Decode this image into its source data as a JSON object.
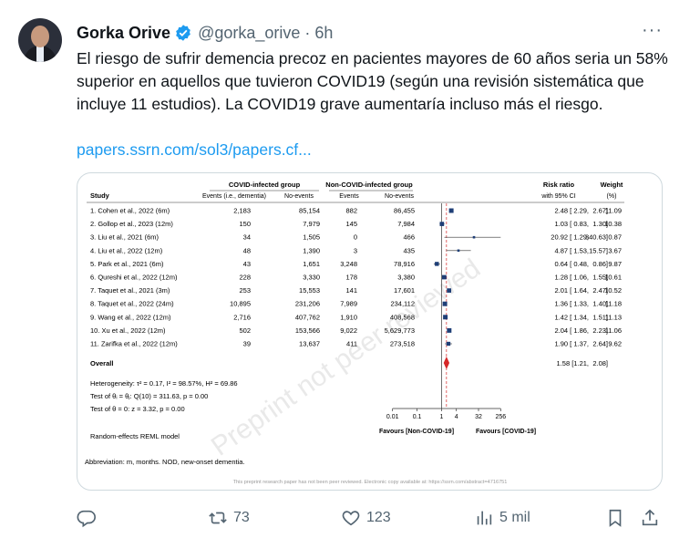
{
  "author": {
    "name": "Gorka Orive",
    "handle": "@gorka_orive",
    "separator": "·",
    "time": "6h",
    "more": "···"
  },
  "tweet": {
    "text": "El riesgo de sufrir demencia precoz en pacientes mayores de 60 años seria un 58% superior en aquellos que tuvieron COVID19 (según una revisión sistemática que incluye 11 estudios). La COVID19 grave aumentaría incluso más el riesgo.",
    "link": "papers.ssrn.com/sol3/papers.cf..."
  },
  "figure": {
    "group_covid": "COVID-infected group",
    "group_noncovid": "Non-COVID-infected group",
    "risk_ratio_label": "Risk ratio",
    "ci_label": "with 95% CI",
    "weight_label": "Weight",
    "weight_unit": "(%)",
    "col_study": "Study",
    "col_events_dementia": "Events (i.e., dementia)",
    "col_noevents": "No-events",
    "col_events": "Events",
    "col_noevents2": "No-events",
    "watermark": "Preprint not peer reviewed",
    "overall_label": "Overall",
    "overall_rr": "1.58 [1.21,",
    "overall_hi": "2.08]",
    "heterogeneity": "Heterogeneity: τ² = 0.17, I² = 98.57%, H² = 69.86",
    "test_theta_i": "Test of θᵢ = θⱼ: Q(10) = 311.63, p = 0.00",
    "test_theta": "Test of θ = 0: z = 3.32, p = 0.00",
    "model": "Random-effects REML model",
    "abbrev": "Abbreviation: m, months. NOD, new-onset dementia.",
    "footer": "This preprint research paper has not been peer reviewed. Electronic copy available at: https://ssrn.com/abstract=4716751",
    "favours_left": "Favours [Non-COVID-19]",
    "favours_right": "Favours [COVID-19]",
    "axis_ticks": [
      "0.01",
      "0.1",
      "1",
      "4",
      "32",
      "256"
    ],
    "studies": [
      {
        "study": "1. Cohen et al., 2022 (6m)",
        "ev": "2,183",
        "noev": "85,154",
        "ev2": "882",
        "noev2": "86,455",
        "rr": 2.48,
        "lo": 2.29,
        "hi": 2.67,
        "rr_text": "2.48 [ 2.29,",
        "hi_text": "2.67]",
        "weight": "11.09"
      },
      {
        "study": "2. Gollop et al., 2023 (12m)",
        "ev": "150",
        "noev": "7,979",
        "ev2": "145",
        "noev2": "7,984",
        "rr": 1.03,
        "lo": 0.83,
        "hi": 1.3,
        "rr_text": "1.03 [ 0.83,",
        "hi_text": "1.30]",
        "weight": "10.38"
      },
      {
        "study": "3. Liu et al., 2021 (6m)",
        "ev": "34",
        "noev": "1,505",
        "ev2": "0",
        "noev2": "466",
        "rr": 20.92,
        "lo": 1.29,
        "hi": 340.63,
        "rr_text": "20.92 [ 1.29,",
        "hi_text": "340.63]",
        "weight": "0.87"
      },
      {
        "study": "4. Liu et al., 2022 (12m)",
        "ev": "48",
        "noev": "1,390",
        "ev2": "3",
        "noev2": "435",
        "rr": 4.87,
        "lo": 1.53,
        "hi": 15.57,
        "rr_text": "4.87 [ 1.53,",
        "hi_text": "15.57]",
        "weight": "3.67"
      },
      {
        "study": "5. Park et al., 2021 (6m)",
        "ev": "43",
        "noev": "1,651",
        "ev2": "3,248",
        "noev2": "78,916",
        "rr": 0.64,
        "lo": 0.48,
        "hi": 0.86,
        "rr_text": "0.64 [ 0.48,",
        "hi_text": "0.86]",
        "weight": "9.87"
      },
      {
        "study": "6. Qureshi et al., 2022 (12m)",
        "ev": "228",
        "noev": "3,330",
        "ev2": "178",
        "noev2": "3,380",
        "rr": 1.28,
        "lo": 1.06,
        "hi": 1.55,
        "rr_text": "1.28 [ 1.06,",
        "hi_text": "1.55]",
        "weight": "10.61"
      },
      {
        "study": "7. Taquet et al., 2021 (3m)",
        "ev": "253",
        "noev": "15,553",
        "ev2": "141",
        "noev2": "17,601",
        "rr": 2.01,
        "lo": 1.64,
        "hi": 2.47,
        "rr_text": "2.01 [ 1.64,",
        "hi_text": "2.47]",
        "weight": "10.52"
      },
      {
        "study": "8. Taquet et al., 2022 (24m)",
        "ev": "10,895",
        "noev": "231,206",
        "ev2": "7,989",
        "noev2": "234,112",
        "rr": 1.36,
        "lo": 1.33,
        "hi": 1.4,
        "rr_text": "1.36 [ 1.33,",
        "hi_text": "1.40]",
        "weight": "11.18"
      },
      {
        "study": "9. Wang et al., 2022 (12m)",
        "ev": "2,716",
        "noev": "407,762",
        "ev2": "1,910",
        "noev2": "408,568",
        "rr": 1.42,
        "lo": 1.34,
        "hi": 1.51,
        "rr_text": "1.42 [ 1.34,",
        "hi_text": "1.51]",
        "weight": "11.13"
      },
      {
        "study": "10. Xu et al., 2022 (12m)",
        "ev": "502",
        "noev": "153,566",
        "ev2": "9,022",
        "noev2": "5,629,773",
        "rr": 2.04,
        "lo": 1.86,
        "hi": 2.23,
        "rr_text": "2.04 [ 1.86,",
        "hi_text": "2.23]",
        "weight": "11.06"
      },
      {
        "study": "11. Zarifka et al., 2022 (12m)",
        "ev": "39",
        "noev": "13,637",
        "ev2": "411",
        "noev2": "273,518",
        "rr": 1.9,
        "lo": 1.37,
        "hi": 2.64,
        "rr_text": "1.90 [ 1.37,",
        "hi_text": "2.64]",
        "weight": "9.62"
      }
    ],
    "overall": {
      "rr": 1.58,
      "lo": 1.21,
      "hi": 2.08
    }
  },
  "chart_data": {
    "type": "scatter",
    "title": "",
    "xlabel": "Risk ratio",
    "x_scale": "log2",
    "x_ticks": [
      "0.01",
      "0.1",
      "1",
      "4",
      "32",
      "256"
    ],
    "categories": [
      "1. Cohen et al., 2022 (6m)",
      "2. Gollop et al., 2023 (12m)",
      "3. Liu et al., 2021 (6m)",
      "4. Liu et al., 2022 (12m)",
      "5. Park et al., 2021 (6m)",
      "6. Qureshi et al., 2022 (12m)",
      "7. Taquet et al., 2021 (3m)",
      "8. Taquet et al., 2022 (24m)",
      "9. Wang et al., 2022 (12m)",
      "10. Xu et al., 2022 (12m)",
      "11. Zarifka et al., 2022 (12m)",
      "Overall"
    ],
    "series": [
      {
        "name": "Risk ratio",
        "values": [
          2.48,
          1.03,
          20.92,
          4.87,
          0.64,
          1.28,
          2.01,
          1.36,
          1.42,
          2.04,
          1.9,
          1.58
        ]
      },
      {
        "name": "95% CI lower",
        "values": [
          2.29,
          0.83,
          1.29,
          1.53,
          0.48,
          1.06,
          1.64,
          1.33,
          1.34,
          1.86,
          1.37,
          1.21
        ]
      },
      {
        "name": "95% CI upper",
        "values": [
          2.67,
          1.3,
          340.63,
          15.57,
          0.86,
          1.55,
          2.47,
          1.4,
          1.51,
          2.23,
          2.64,
          2.08
        ]
      },
      {
        "name": "Weight (%)",
        "values": [
          11.09,
          10.38,
          0.87,
          3.67,
          9.87,
          10.61,
          10.52,
          11.18,
          11.13,
          11.06,
          9.62
        ]
      }
    ]
  },
  "actions": {
    "reply_count": "",
    "retweet_count": "73",
    "like_count": "123",
    "views_count": "5 mil"
  },
  "colors": {
    "accent": "#1d9bf0",
    "text_secondary": "#536471",
    "marker": "#1f3f77",
    "overall_diamond": "#d62728"
  }
}
